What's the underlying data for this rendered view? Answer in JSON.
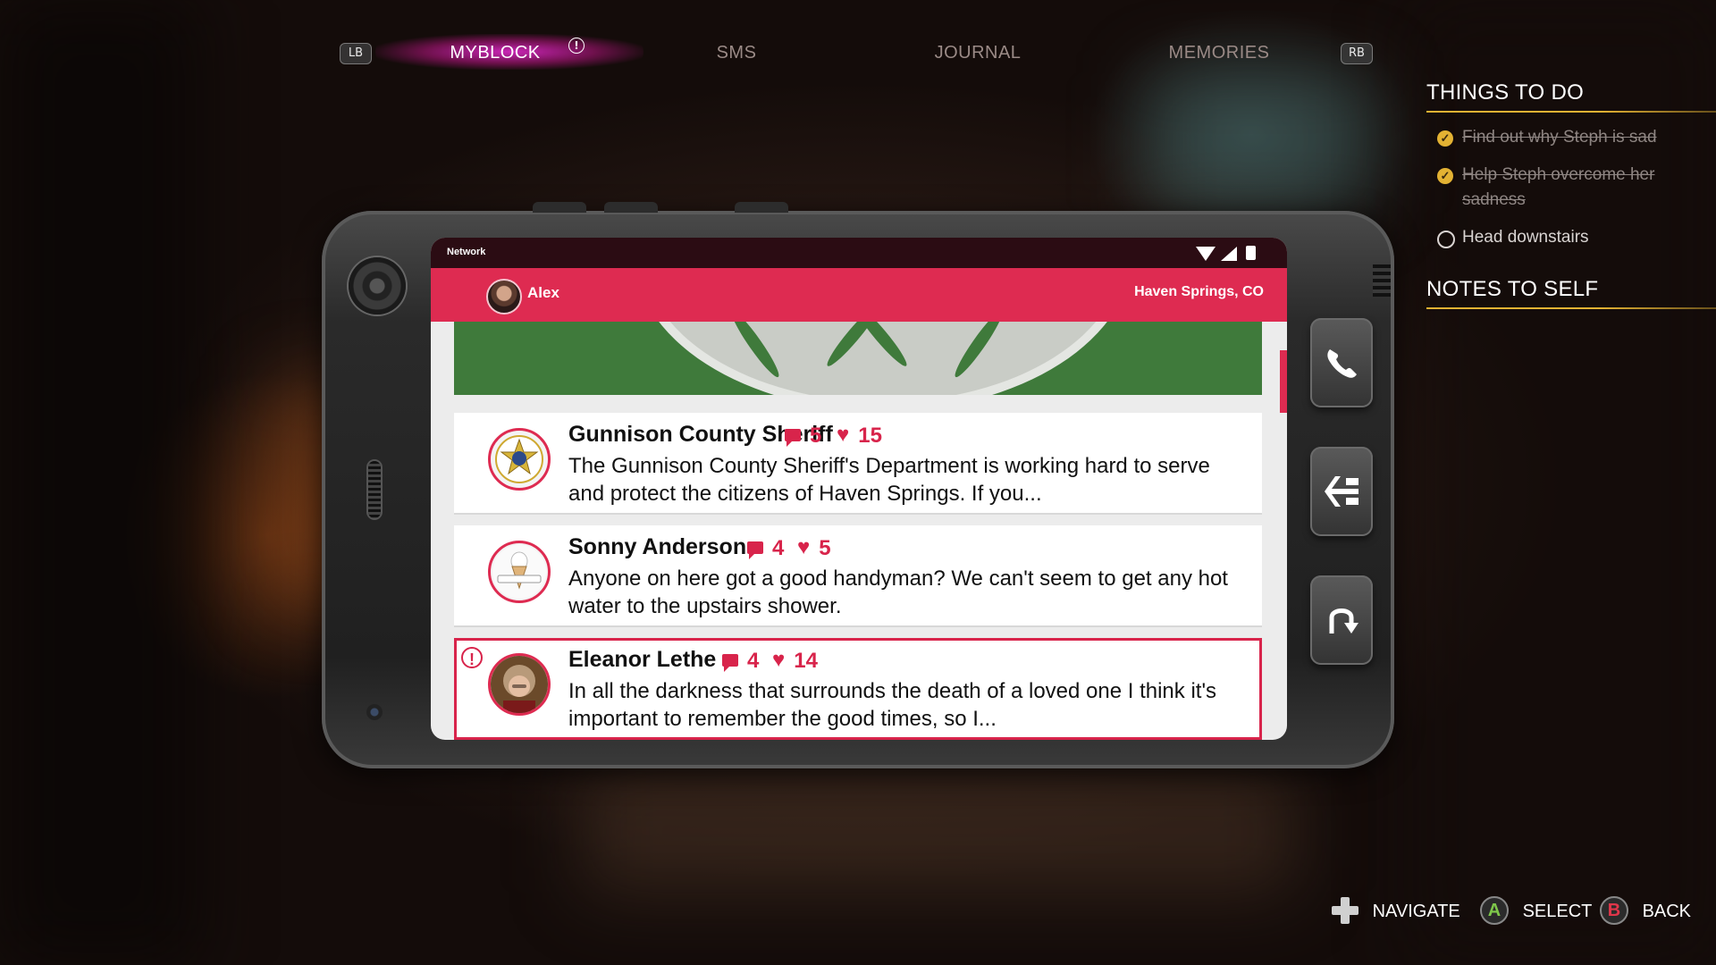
{
  "tabs": {
    "left_bumper": "LB",
    "right_bumper": "RB",
    "items": [
      {
        "label": "MYBLOCK",
        "active": true,
        "alert": "!"
      },
      {
        "label": "SMS",
        "active": false
      },
      {
        "label": "JOURNAL",
        "active": false
      },
      {
        "label": "MEMORIES",
        "active": false
      }
    ]
  },
  "phone": {
    "status_bar": {
      "label": "Network",
      "icons": [
        "wifi-icon",
        "signal-icon",
        "battery-icon"
      ]
    },
    "app_bar": {
      "user": "Alex",
      "location": "Haven Springs, CO"
    },
    "posts": [
      {
        "author": "Gunnison County Sheriff",
        "comments": "5",
        "likes": "15",
        "text": "The Gunnison County Sheriff's Department is working hard to serve and protect the citizens of Haven Springs. If you...",
        "avatar": "sheriff-badge",
        "highlighted": false
      },
      {
        "author": "Sonny Anderson",
        "comments": "4",
        "likes": "5",
        "text": "Anyone on here got a good handyman? We can't seem to get any hot water to the upstairs shower.",
        "avatar": "ice-cream-logo",
        "highlighted": false
      },
      {
        "author": "Eleanor Lethe",
        "comments": "4",
        "likes": "14",
        "text": "In all the darkness that surrounds the death of a loved one I think it's important to remember the good times, so I...",
        "avatar": "eleanor-portrait",
        "highlighted": true,
        "alert": "!"
      }
    ],
    "side_buttons": [
      "phone-call-icon",
      "network-icon",
      "back-arrow-icon"
    ]
  },
  "things_to_do": {
    "title": "THINGS TO DO",
    "tasks": [
      {
        "label": "Find out why Steph is sad",
        "done": true
      },
      {
        "label": "Help Steph overcome her sadness",
        "done": true
      },
      {
        "label": "Head downstairs",
        "done": false
      }
    ]
  },
  "notes_to_self": {
    "title": "NOTES TO SELF"
  },
  "hints": [
    {
      "icon": "dpad-icon",
      "label": "NAVIGATE"
    },
    {
      "icon": "a-button-icon",
      "glyph": "A",
      "label": "SELECT"
    },
    {
      "icon": "b-button-icon",
      "glyph": "B",
      "label": "BACK"
    }
  ],
  "colors": {
    "accent": "#de2b51",
    "status_bar": "#2b0c13",
    "task_gold": "#e3b233",
    "tab_glow": "#dc28c8"
  }
}
